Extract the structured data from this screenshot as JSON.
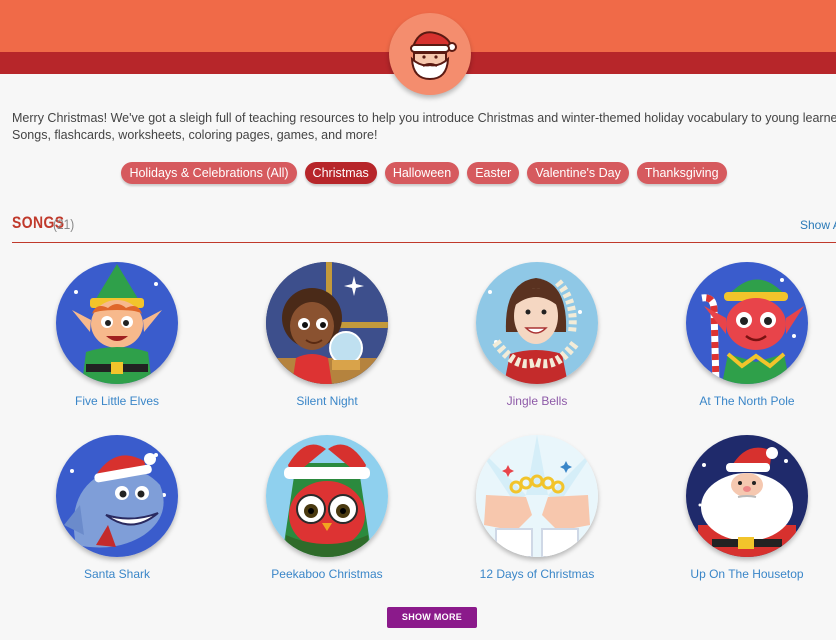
{
  "intro": {
    "line1": "Merry Christmas! We've got a sleigh full of teaching resources to help you introduce Christmas and winter-themed holiday vocabulary to young learners!",
    "line2": "Songs, flashcards, worksheets, coloring pages, games, and more!"
  },
  "categories": [
    {
      "label": "Holidays & Celebrations (All)",
      "active": false
    },
    {
      "label": "Christmas",
      "active": true
    },
    {
      "label": "Halloween",
      "active": false
    },
    {
      "label": "Easter",
      "active": false
    },
    {
      "label": "Valentine's Day",
      "active": false
    },
    {
      "label": "Thanksgiving",
      "active": false
    }
  ],
  "songs_section": {
    "title": "SONGS",
    "count": "(21)",
    "show_all": "Show All"
  },
  "songs": [
    {
      "title": "Five Little Elves",
      "icon": "elf-icon"
    },
    {
      "title": "Silent Night",
      "icon": "girl-snowglobe-icon"
    },
    {
      "title": "Jingle Bells",
      "icon": "woman-tinsel-icon"
    },
    {
      "title": "At The North Pole",
      "icon": "elf-candycane-icon"
    },
    {
      "title": "Santa Shark",
      "icon": "shark-santa-hat-icon"
    },
    {
      "title": "Peekaboo Christmas",
      "icon": "owl-santa-hat-icon"
    },
    {
      "title": "12 Days of Christmas",
      "icon": "hands-rings-icon"
    },
    {
      "title": "Up On The Housetop",
      "icon": "santa-icon"
    }
  ],
  "show_more": "SHOW MORE",
  "colors": {
    "header_orange": "#f06a48",
    "header_red": "#b7262a",
    "pill": "#d65a5e",
    "pill_active": "#b7262a",
    "link": "#3a86c8",
    "visited_link": "#8e5aa8",
    "button": "#8b1a8b"
  }
}
